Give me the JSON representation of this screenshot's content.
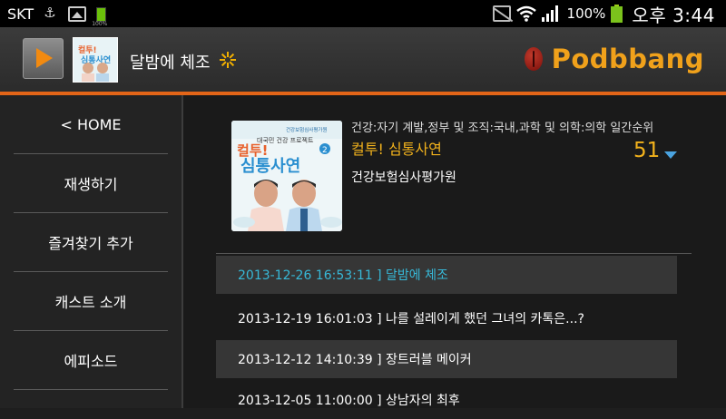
{
  "status_bar": {
    "carrier": "SKT",
    "battery_small_label": "100%",
    "battery_percent": "100%",
    "time": "오후 3:44",
    "icons": [
      "usb-icon",
      "image-icon",
      "battery-icon",
      "mute-icon",
      "wifi-icon",
      "signal-icon",
      "battery-icon"
    ]
  },
  "header": {
    "now_playing_title": "달밤에 체조",
    "brand": "Podbbang",
    "accent_color": "#e36518",
    "brand_color": "#f0a11b"
  },
  "sidebar": {
    "items": [
      {
        "label": "< HOME"
      },
      {
        "label": "재생하기"
      },
      {
        "label": "즐겨찾기 추가"
      },
      {
        "label": "캐스트 소개"
      },
      {
        "label": "에피소드"
      }
    ]
  },
  "podcast": {
    "category": "건강:자기 계발,정부 및 조직:국내,과학 및 의학:의학  일간순위",
    "title": "컬투! 심통사연",
    "rank": "51",
    "publisher": "건강보험심사평가원",
    "cover_texts": {
      "caption": "대국민 건강 프로젝트",
      "org": "건강보험심사평가원",
      "logo_line1": "컬투!",
      "logo_line2": "심통사연",
      "season": "2"
    }
  },
  "episodes": [
    {
      "text": "2013-12-26 16:53:11 ] 달밤에 체조",
      "active": true
    },
    {
      "text": "2013-12-19 16:01:03 ] 나를 설레이게 했던 그녀의 카톡은...?",
      "active": false
    },
    {
      "text": "2013-12-12 14:10:39 ] 장트러블 메이커",
      "active": false
    },
    {
      "text": "2013-12-05 11:00:00 ] 상남자의 최후",
      "active": false
    }
  ],
  "colors": {
    "highlight_yellow": "#f2b21c",
    "active_blue": "#37b9d8"
  }
}
